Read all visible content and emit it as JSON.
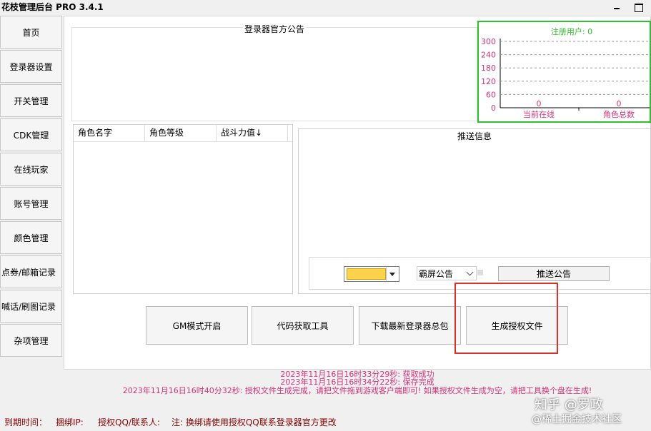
{
  "window": {
    "title": "花枝管理后台 PRO 3.4.1"
  },
  "sidebar": {
    "items": [
      {
        "label": "首页"
      },
      {
        "label": "登录器设置"
      },
      {
        "label": "开关管理"
      },
      {
        "label": "CDK管理"
      },
      {
        "label": "在线玩家"
      },
      {
        "label": "账号管理"
      },
      {
        "label": "颜色管理"
      },
      {
        "label": "点券/邮箱记录"
      },
      {
        "label": "喊话/刷图记录"
      },
      {
        "label": "杂项管理"
      }
    ]
  },
  "notice": {
    "title": "登录器官方公告"
  },
  "stats": {
    "title": "注册用户: 0",
    "y_ticks": [
      "300",
      "240",
      "180",
      "120",
      "60",
      "0"
    ],
    "bars": [
      {
        "label": "当前在线",
        "value": "0"
      },
      {
        "label": "角色总数",
        "value": "0"
      }
    ],
    "colors": {
      "border": "#2ec02e",
      "title": "#2ec02e",
      "labels": "#d3327a",
      "grid": "#9a9a9a"
    }
  },
  "chart_data": {
    "type": "bar",
    "title": "注册用户: 0",
    "categories": [
      "当前在线",
      "角色总数"
    ],
    "values": [
      0,
      0
    ],
    "ylim": [
      0,
      300
    ],
    "yticks": [
      0,
      60,
      120,
      180,
      240,
      300
    ],
    "grid": true
  },
  "role_table": {
    "columns": [
      "角色名字",
      "角色等级",
      "战斗力值↓"
    ],
    "rows": []
  },
  "push": {
    "title": "推送信息",
    "color_value": "#ffd24d",
    "type_value": "霸屏公告",
    "send_label": "推送公告"
  },
  "tools": {
    "buttons": [
      {
        "label": "GM模式开启"
      },
      {
        "label": "代码获取工具"
      },
      {
        "label": "下载最新登录器总包"
      },
      {
        "label": "生成授权文件"
      }
    ]
  },
  "log": {
    "lines": [
      "2023年11月16日16时33分29秒: 获取成功",
      "2023年11月16日16时34分22秒: 保存完成",
      "2023年11月16日16时40分32秒: 授权文件生成完成，请把文件拖到游戏客户端即可!  如果授权文件生成为空，请把工具换个盘在生成!"
    ],
    "color": "#d3327a"
  },
  "status": {
    "expiry_label": "到期时间：",
    "bind_ip_label": "捆绑IP:",
    "contact_label": "授权QQ/联系人:",
    "note": "注: 换绑请使用授权QQ联系登录器官方更改"
  },
  "watermark": {
    "line1": "知乎 @罗政",
    "line2": "@稀土掘金技术社区"
  }
}
